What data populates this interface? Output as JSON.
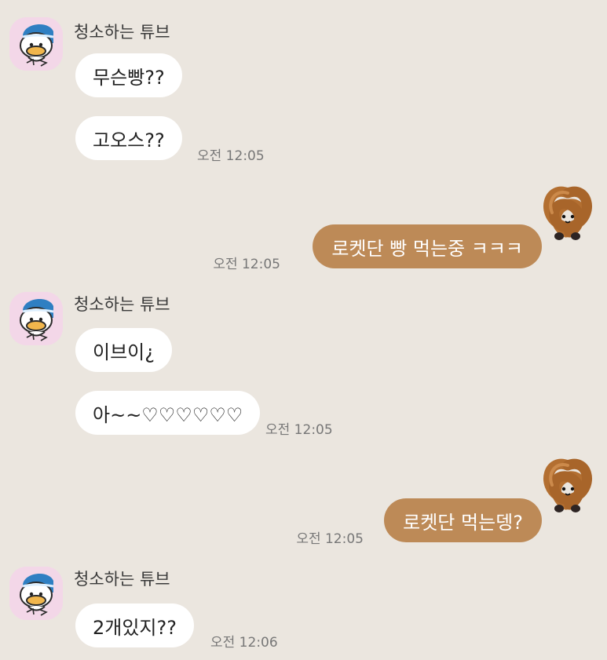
{
  "chat": {
    "groups": [
      {
        "type": "incoming",
        "sender_name": "청소하는 튜브",
        "messages": [
          "무슨빵??",
          "고오스??"
        ],
        "time": "오전 12:05"
      },
      {
        "type": "outgoing",
        "messages": [
          "로켓단 빵 먹는중 ㅋㅋㅋ"
        ],
        "time": "오전 12:05"
      },
      {
        "type": "incoming",
        "sender_name": "청소하는 튜브",
        "messages": [
          "이브이¿",
          "아~~♡♡♡♡♡♡"
        ],
        "time": "오전 12:05"
      },
      {
        "type": "outgoing",
        "messages": [
          "로켓단 먹는뎅?"
        ],
        "time": "오전 12:05"
      },
      {
        "type": "incoming",
        "sender_name": "청소하는 튜브",
        "messages": [
          "2개있지??"
        ],
        "time": "오전 12:06"
      }
    ]
  },
  "icons": {
    "incoming_avatar": "tube-duck-avatar-icon",
    "outgoing_avatar": "pretzel-plush-avatar-icon"
  },
  "colors": {
    "background": "#ebe6df",
    "incoming_bubble": "#ffffff",
    "outgoing_bubble": "#bd8a57",
    "avatar_background": "#f3d7e8"
  }
}
